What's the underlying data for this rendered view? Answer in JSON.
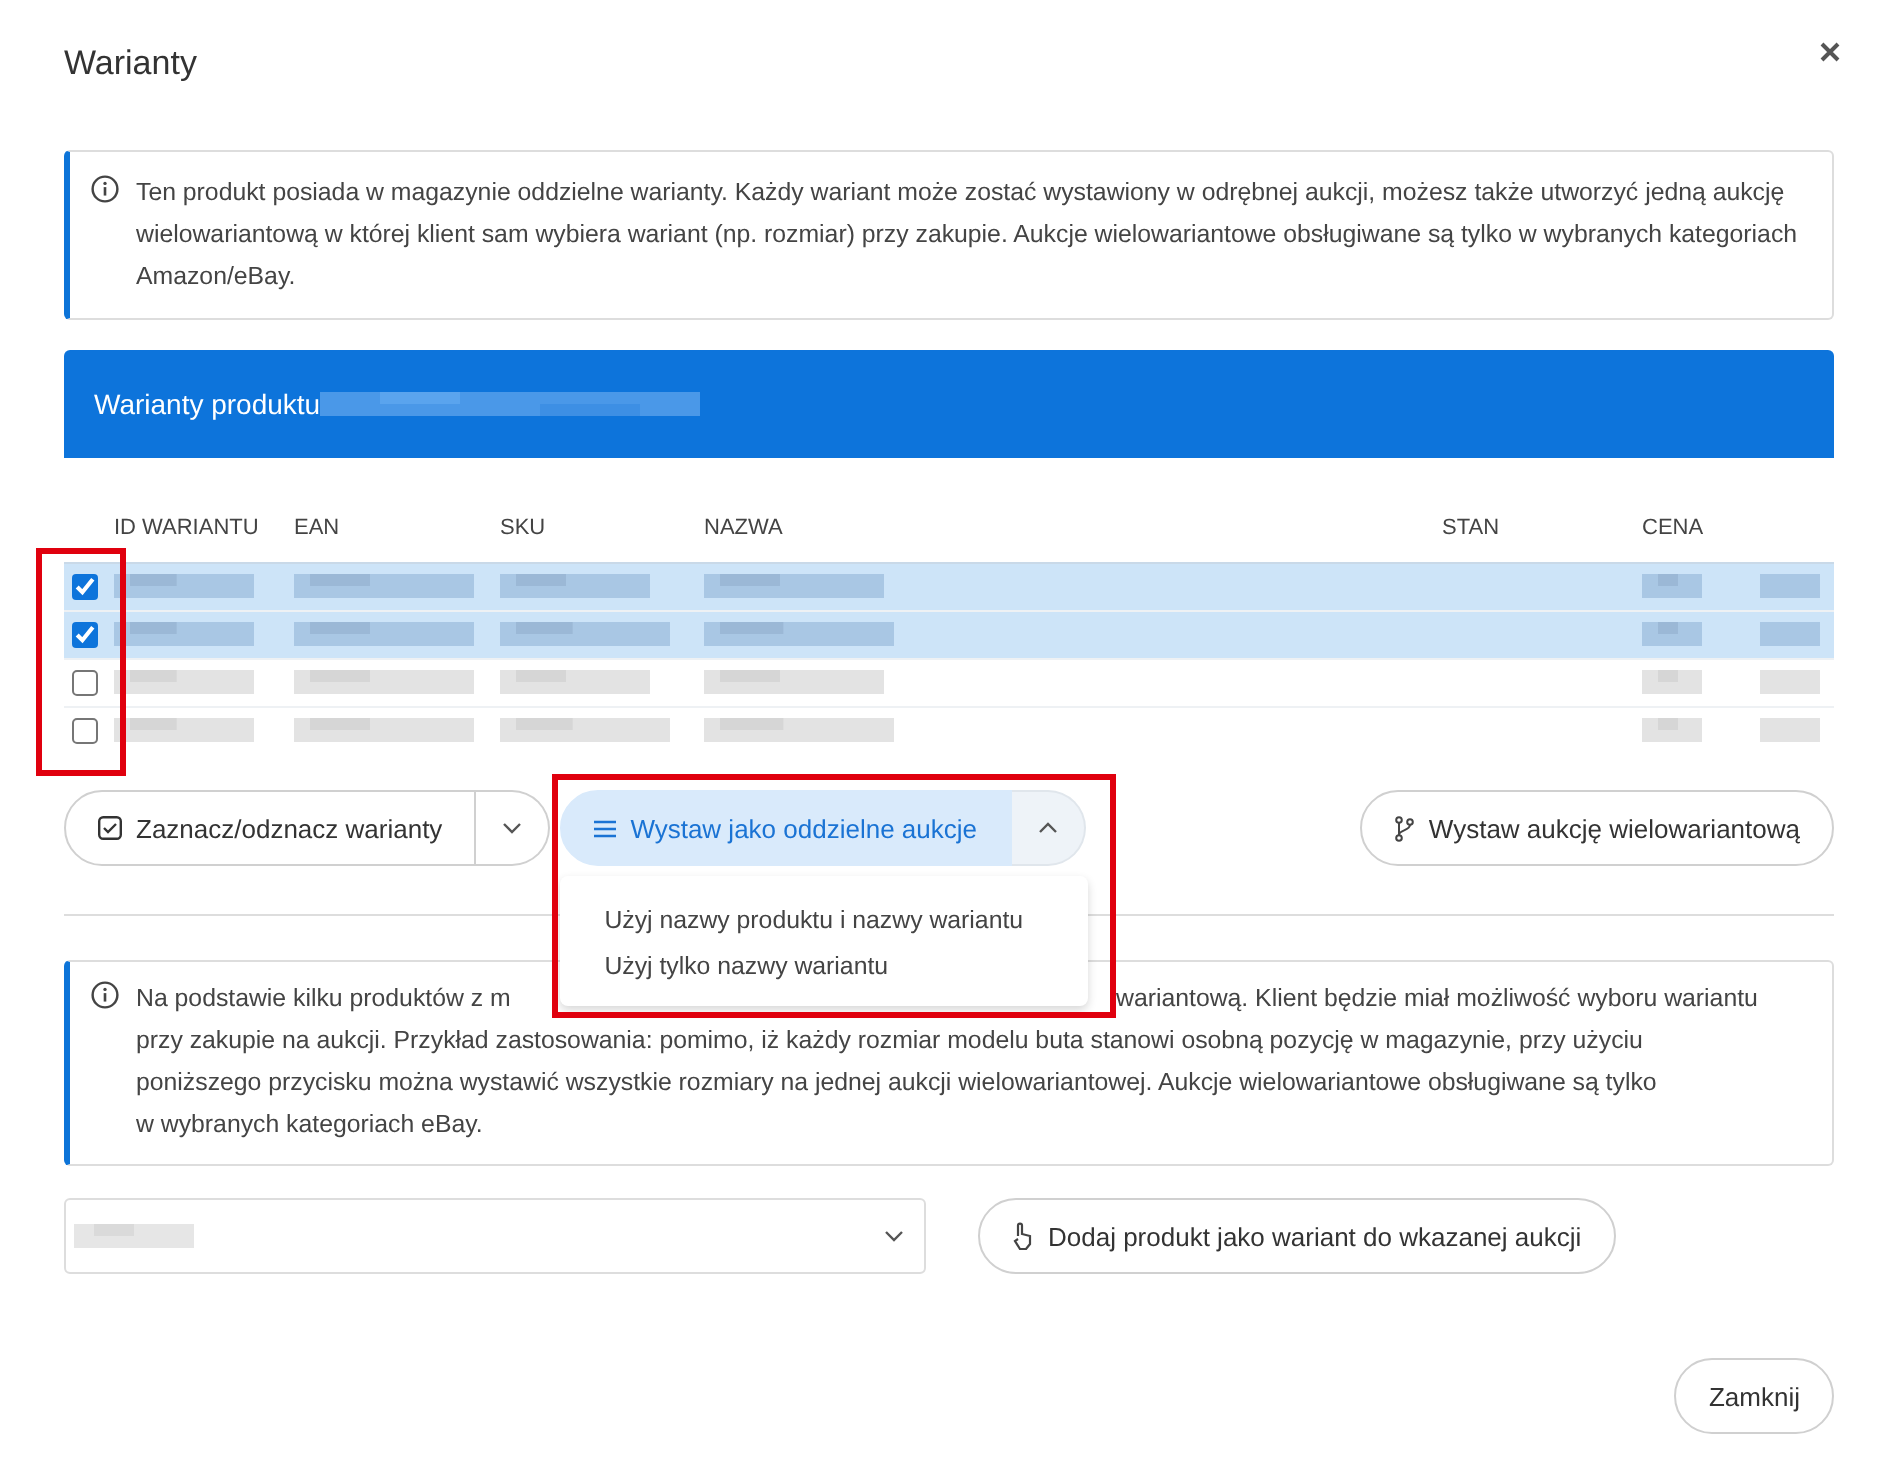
{
  "dialog": {
    "title": "Warianty"
  },
  "info_top": {
    "text": "Ten produkt posiada w magazynie oddzielne warianty. Każdy wariant może zostać wystawiony w odrębnej aukcji, możesz także utworzyć jedną aukcję wielowariantową w której klient sam wybiera wariant (np. rozmiar) przy zakupie. Aukcje wielowariantowe obsługiwane są tylko w wybranych kategoriach Amazon/eBay."
  },
  "variants_panel": {
    "title": "Warianty produktu"
  },
  "table": {
    "columns": [
      "ID WARIANTU",
      "EAN",
      "SKU",
      "NAZWA",
      "STAN",
      "CENA"
    ],
    "rows": [
      {
        "selected": true,
        "checked": true
      },
      {
        "selected": true,
        "checked": true
      },
      {
        "selected": false,
        "checked": false
      },
      {
        "selected": false,
        "checked": false
      }
    ]
  },
  "actions": {
    "toggle_button": "Zaznacz/odznacz warianty",
    "split_button": "Wystaw jako oddzielne aukcje",
    "split_expanded": true,
    "multi_button": "Wystaw aukcję wielowariantową"
  },
  "split_menu": [
    "Użyj nazwy produktu i nazwy wariantu",
    "Użyj tylko nazwy wariantu"
  ],
  "info_bottom": {
    "first_line": [
      "Na podstawie kilku produktów z m",
      "wariantową. Klient będzie miał możliwość wyboru wariantu"
    ],
    "lines": [
      "przy zakupie na aukcji. Przykład zastosowania: pomimo, iż każdy rozmiar modelu buta stanowi osobną pozycję w magazynie, przy użyciu",
      "poniższego przycisku można wystawić wszystkie rozmiary na jednej aukcji wielowariantowej. Aukcje wielowariantowe obsługiwane są tylko",
      "w wybranych kategoriach eBay."
    ]
  },
  "add_button": "Dodaj produkt jako wariant do wkazanej aukcji",
  "footer": {
    "close_button": "Zamknij"
  }
}
